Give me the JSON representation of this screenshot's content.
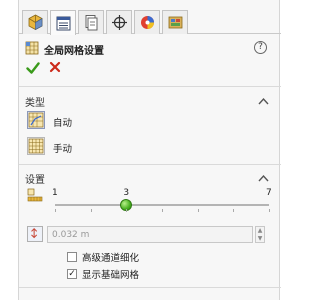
{
  "tabs": [
    {
      "icon": "feature-manager-icon"
    },
    {
      "icon": "property-manager-icon",
      "active": true
    },
    {
      "icon": "configuration-manager-icon"
    },
    {
      "icon": "dimxpert-icon"
    },
    {
      "icon": "display-manager-icon"
    },
    {
      "icon": "simulation-icon"
    }
  ],
  "header": {
    "title": "全局网格设置",
    "help": "?"
  },
  "type_section": {
    "title": "类型",
    "options": [
      {
        "label": "自动",
        "selected": true
      },
      {
        "label": "手动",
        "selected": false
      }
    ]
  },
  "settings_section": {
    "title": "设置",
    "slider": {
      "min_label": "1",
      "value_label": "3",
      "max_label": "7",
      "min": 1,
      "max": 7,
      "value": 3
    },
    "size_value": "0.032 m",
    "checkboxes": [
      {
        "label": "高级通道细化",
        "checked": false
      },
      {
        "label": "显示基础网格",
        "checked": true
      }
    ]
  },
  "colors": {
    "accent_green": "#48b020",
    "cancel_red": "#cc2a1a"
  }
}
